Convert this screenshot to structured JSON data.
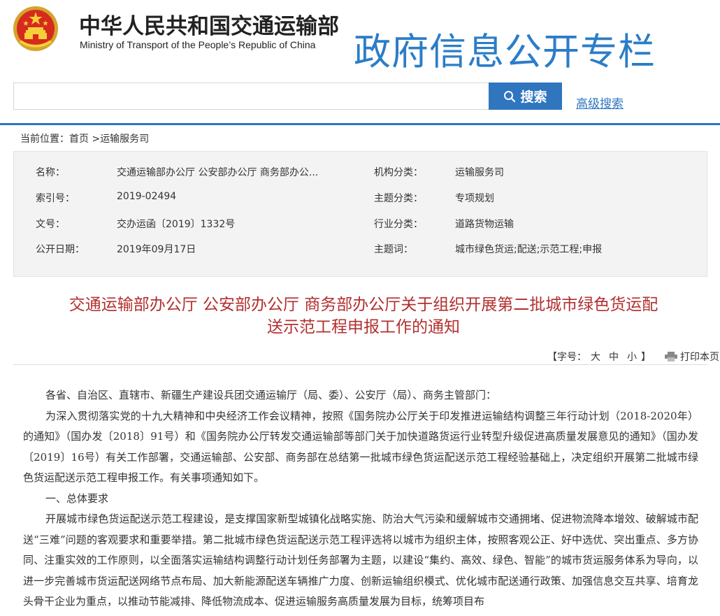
{
  "header": {
    "ministry_cn": "中华人民共和国交通运输部",
    "ministry_en": "Ministry of Transport of the People’s Republic of China",
    "column_title": "政府信息公开专栏"
  },
  "search": {
    "placeholder": "",
    "button_label": "搜索",
    "advanced_label": "高级搜索"
  },
  "breadcrumb": {
    "prefix": "当前位置：",
    "home": "首页",
    "separator": " >",
    "current": "运输服务司"
  },
  "meta": {
    "left": [
      {
        "label": "名称：",
        "value": "交通运输部办公厅 公安部办公厅 商务部办公..."
      },
      {
        "label": "索引号：",
        "value": "2019-02494"
      },
      {
        "label": "文号：",
        "value": "交办运函〔2019〕1332号"
      },
      {
        "label": "公开日期：",
        "value": "2019年09月17日"
      }
    ],
    "right": [
      {
        "label": "机构分类：",
        "value": "运输服务司"
      },
      {
        "label": "主题分类：",
        "value": "专项规划"
      },
      {
        "label": "行业分类：",
        "value": "道路货物运输"
      },
      {
        "label": "主题词：",
        "value": "城市绿色货运;配送;示范工程;申报"
      }
    ]
  },
  "document": {
    "title_line1": "交通运输部办公厅 公安部办公厅 商务部办公厅关于组织开展第二批城市绿色货运配",
    "title_line2": "送示范工程申报工作的通知",
    "font_label": "【字号：",
    "font_large": "大",
    "font_medium": "中",
    "font_small": "小",
    "font_close": "】",
    "print_label": "打印本页",
    "paragraphs": [
      "各省、自治区、直辖市、新疆生产建设兵团交通运输厅（局、委）、公安厅（局）、商务主管部门：",
      "为深入贯彻落实党的十九大精神和中央经济工作会议精神，按照《国务院办公厅关于印发推进运输结构调整三年行动计划（2018-2020年）的通知》（国办发〔2018〕91号）和《国务院办公厅转发交通运输部等部门关于加快道路货运行业转型升级促进高质量发展意见的通知》（国办发〔2019〕16号）有关工作部署，交通运输部、公安部、商务部在总结第一批城市绿色货运配送示范工程经验基础上，决定组织开展第二批城市绿色货运配送示范工程申报工作。有关事项通知如下。",
      "一、总体要求",
      "开展城市绿色货运配送示范工程建设，是支撑国家新型城镇化战略实施、防治大气污染和缓解城市交通拥堵、促进物流降本增效、破解城市配送“三难”问题的客观要求和重要举措。第二批城市绿色货运配送示范工程评选将以城市为组织主体，按照客观公正、好中选优、突出重点、多方协同、注重实效的工作原则，以全面落实运输结构调整行动计划任务部署为主题，以建设“集约、高效、绿色、智能”的城市货运服务体系为导向，以进一步完善城市货运配送网络节点布局、加大新能源配送车辆推广力度、创新运输组织模式、优化城市配送通行政策、加强信息交互共享、培育龙头骨干企业为重点，以推动节能减排、降低物流成本、促进运输服务高质量发展为目标，统筹项目布"
    ]
  },
  "colors": {
    "brand_blue": "#2f76bf",
    "title_red": "#b32f2f",
    "column_blue": "#2b7dc8"
  },
  "icons": {
    "emblem": "national-emblem-icon",
    "search": "search-icon",
    "print": "printer-icon"
  }
}
